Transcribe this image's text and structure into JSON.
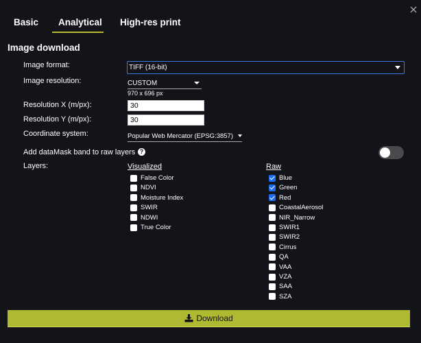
{
  "tabs": [
    {
      "label": "Basic",
      "active": false
    },
    {
      "label": "Analytical",
      "active": true
    },
    {
      "label": "High-res print",
      "active": false
    }
  ],
  "section_title": "Image download",
  "form": {
    "image_format": {
      "label": "Image format:",
      "value": "TIFF (16-bit)"
    },
    "image_resolution": {
      "label": "Image resolution:",
      "value": "CUSTOM",
      "size_text": "970 x 696 px"
    },
    "resolution_x": {
      "label": "Resolution X (m/px):",
      "value": "30"
    },
    "resolution_y": {
      "label": "Resolution Y (m/px):",
      "value": "30"
    },
    "coordinate_system": {
      "label": "Coordinate system:",
      "value": "Popular Web Mercator (EPSG:3857)"
    },
    "datamask": {
      "label": "Add dataMask band to raw layers",
      "help_icon": "?",
      "enabled": false
    },
    "layers_label": "Layers:"
  },
  "layers": {
    "visualized": {
      "header": "Visualized",
      "items": [
        {
          "label": "False Color",
          "checked": false
        },
        {
          "label": "NDVI",
          "checked": false
        },
        {
          "label": "Moisture Index",
          "checked": false
        },
        {
          "label": "SWIR",
          "checked": false
        },
        {
          "label": "NDWI",
          "checked": false
        },
        {
          "label": "True Color",
          "checked": false
        }
      ]
    },
    "raw": {
      "header": "Raw",
      "items": [
        {
          "label": "Blue",
          "checked": true
        },
        {
          "label": "Green",
          "checked": true
        },
        {
          "label": "Red",
          "checked": true
        },
        {
          "label": "CoastalAerosol",
          "checked": false
        },
        {
          "label": "NIR_Narrow",
          "checked": false
        },
        {
          "label": "SWIR1",
          "checked": false
        },
        {
          "label": "SWIR2",
          "checked": false
        },
        {
          "label": "Cirrus",
          "checked": false
        },
        {
          "label": "QA",
          "checked": false
        },
        {
          "label": "VAA",
          "checked": false
        },
        {
          "label": "VZA",
          "checked": false
        },
        {
          "label": "SAA",
          "checked": false
        },
        {
          "label": "SZA",
          "checked": false
        }
      ]
    }
  },
  "download_button": {
    "label": "Download",
    "icon": "download-icon"
  },
  "colors": {
    "accent": "#b0b932",
    "checkbox_checked": "#1a6cf0",
    "background": "#131419"
  }
}
